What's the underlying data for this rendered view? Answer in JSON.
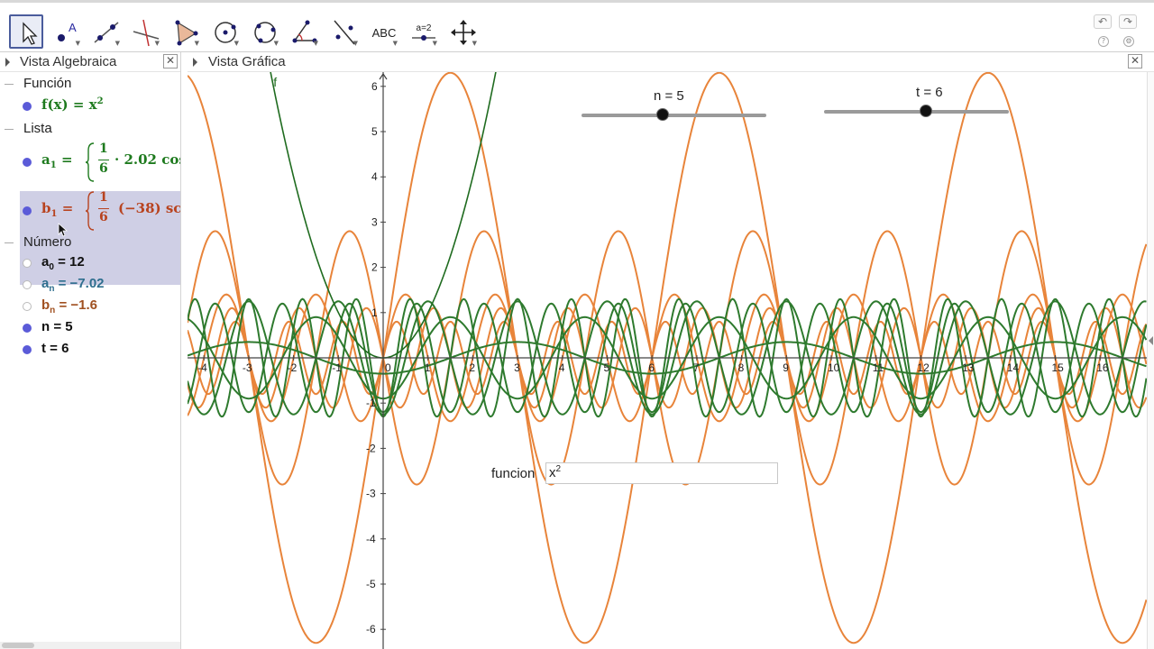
{
  "toolbar": {
    "tools": [
      "move",
      "point",
      "line",
      "perpendicular",
      "polygon",
      "circle-center",
      "circle-three-points",
      "angle",
      "reflect",
      "text",
      "slider",
      "move-view"
    ],
    "text_tool_label": "ABC",
    "slider_tool_label": "a=2"
  },
  "algebra": {
    "title": "Vista Algebraica",
    "categories": {
      "funcion": "Función",
      "lista": "Lista",
      "numero": "Número"
    },
    "f": {
      "name": "f(x)",
      "eq": "=",
      "value_base": "x",
      "value_exp": "2"
    },
    "a1": {
      "name": "a",
      "sub": "1",
      "eq": "=",
      "num": "1",
      "den": "6",
      "rest": "· 2.02 cos"
    },
    "b1": {
      "name": "b",
      "sub": "1",
      "eq": "=",
      "num": "1",
      "den": "6",
      "rest": "(−38) sc"
    },
    "numbers": [
      {
        "name": "a",
        "sub": "0",
        "value": "= 12",
        "color": "#111111",
        "visible": false
      },
      {
        "name": "a",
        "sub": "n",
        "value": "= −7.02",
        "color": "#2e6e8e",
        "visible": false
      },
      {
        "name": "b",
        "sub": "n",
        "value": "= −1.6",
        "color": "#a05020",
        "visible": false
      },
      {
        "name": "n",
        "sub": "",
        "value": "= 5",
        "color": "#111111",
        "visible": true
      },
      {
        "name": "t",
        "sub": "",
        "value": "= 6",
        "color": "#111111",
        "visible": true
      }
    ]
  },
  "graphics": {
    "title": "Vista Gráfica",
    "function_label": "f",
    "slider_n": {
      "label": "n = 5",
      "value": 5,
      "fraction": 0.44
    },
    "slider_t": {
      "label": "t = 6",
      "value": 6,
      "fraction": 0.55
    },
    "input": {
      "label": "funcion",
      "base": "x",
      "exp": "2"
    },
    "x_ticks": [
      "-4",
      "-3",
      "-2",
      "-1",
      "0",
      "1",
      "2",
      "3",
      "4",
      "5",
      "6",
      "7",
      "8",
      "9",
      "10",
      "11",
      "12",
      "13",
      "14",
      "15",
      "16"
    ],
    "y_ticks": [
      "-6",
      "-5",
      "-4",
      "-3",
      "-2",
      "-1",
      "1",
      "2",
      "3",
      "4",
      "5",
      "6"
    ],
    "colors": {
      "orange": "#e8843a",
      "green": "#2e7a2e",
      "dark_green": "#1f6b1f",
      "axis": "#444444"
    }
  },
  "colors": {
    "selection": "#cfcfe5",
    "dot": "#5b5bd8",
    "f_color": "#1e7a1e",
    "b1_color": "#b8431f"
  }
}
